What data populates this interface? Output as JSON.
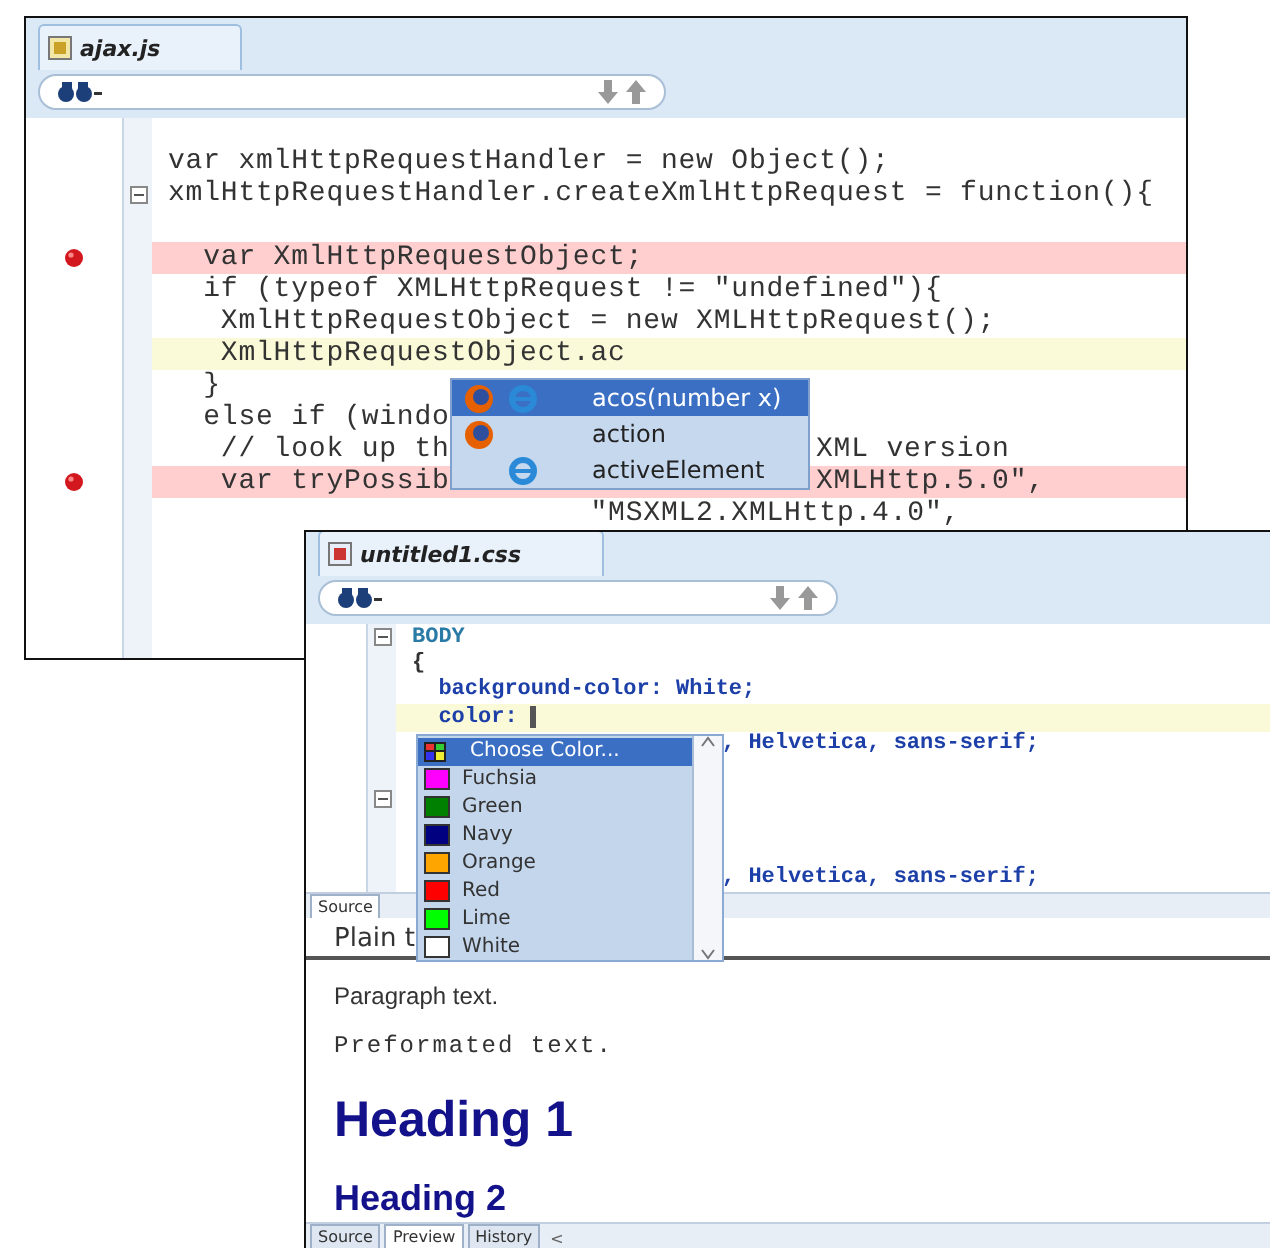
{
  "script_editor": {
    "tab": "ajax.js",
    "lines": [
      {
        "breakpoint": false,
        "current": false,
        "fold": false
      },
      {
        "text": "var xmlHttpRequestHandler = new Object();",
        "breakpoint": false,
        "current": false,
        "fold": false
      },
      {
        "text": "xmlHttpRequestHandler.createXmlHttpRequest = function(){",
        "breakpoint": false,
        "current": false,
        "fold": true
      },
      {
        "breakpoint": false,
        "current": false,
        "fold": false
      },
      {
        "text": "  var XmlHttpRequestObject;",
        "breakpoint": true,
        "current": false,
        "fold": false
      },
      {
        "text": "  if (typeof XMLHttpRequest != \"undefined\"){",
        "breakpoint": false,
        "current": false,
        "fold": false
      },
      {
        "text": "   XmlHttpRequestObject = new XMLHttpRequest();",
        "breakpoint": false,
        "current": false,
        "fold": false
      },
      {
        "text": "   XmlHttpRequestObject.ac",
        "breakpoint": false,
        "current": true,
        "fold": false
      },
      {
        "text": "  }",
        "breakpoint": false,
        "current": false,
        "fold": false
      },
      {
        "text": "  else if (windo",
        "breakpoint": false,
        "current": false,
        "fold": false
      },
      {
        "text": "   // look up th",
        "text_after": "XML version",
        "breakpoint": false,
        "current": false,
        "fold": false
      },
      {
        "text": "   var tryPossib",
        "text_after": "XMLHttp.5.0\",",
        "breakpoint": true,
        "current": false,
        "fold": false
      },
      {
        "text": "                        \"MSXML2.XMLHttp.4.0\",",
        "breakpoint": false,
        "current": false,
        "fold": false
      }
    ],
    "completion": [
      {
        "label": "acos(number x)",
        "selected": true,
        "firefox": true,
        "ie": true
      },
      {
        "label": "action",
        "selected": false,
        "firefox": true,
        "ie": false
      },
      {
        "label": "activeElement",
        "selected": false,
        "firefox": false,
        "ie": true
      }
    ]
  },
  "css_editor": {
    "tab": "untitled1.css",
    "lines": [
      {
        "text": "BODY",
        "kind": "selector",
        "current": false,
        "fold": true
      },
      {
        "text": "{",
        "kind": "plain",
        "current": false,
        "fold": false
      },
      {
        "text": "  background-color: White;",
        "kind": "rule",
        "current": false,
        "fold": false
      },
      {
        "text": "  color: ",
        "kind": "rule",
        "current": true,
        "fold": false
      },
      {
        "text_after": ", Helvetica, sans-serif;",
        "kind": "rule",
        "current": false,
        "fold": false
      },
      {
        "current": false,
        "fold": false
      },
      {
        "current": false,
        "fold": true
      },
      {
        "current": false,
        "fold": false
      },
      {
        "current": false,
        "fold": false
      },
      {
        "text_after": ", Helvetica, sans-serif;",
        "kind": "rule",
        "current": false,
        "fold": false
      }
    ],
    "source_tab": "Source",
    "color_menu": [
      {
        "label": "Choose Color...",
        "kind": "chooser",
        "selected": true
      },
      {
        "label": "Fuchsia",
        "kind": "swatch",
        "color": "#ff00ff",
        "selected": false
      },
      {
        "label": "Green",
        "kind": "swatch",
        "color": "#008000",
        "selected": false
      },
      {
        "label": "Navy",
        "kind": "swatch",
        "color": "#000080",
        "selected": false
      },
      {
        "label": "Orange",
        "kind": "swatch",
        "color": "#ffa500",
        "selected": false
      },
      {
        "label": "Red",
        "kind": "swatch",
        "color": "#ff0000",
        "selected": false
      },
      {
        "label": "Lime",
        "kind": "swatch",
        "color": "#00ff00",
        "selected": false
      },
      {
        "label": "White",
        "kind": "swatch",
        "color": "#ffffff",
        "selected": false
      }
    ],
    "preview": [
      {
        "kind": "plain",
        "text": "Plain t"
      },
      {
        "kind": "paragraph",
        "text": "Paragraph text."
      },
      {
        "kind": "pre",
        "text": "Preformated text."
      },
      {
        "kind": "h1",
        "text": "Heading 1"
      },
      {
        "kind": "h2",
        "text": "Heading 2"
      }
    ],
    "view_tabs": [
      {
        "label": "Source",
        "selected": false
      },
      {
        "label": "Preview",
        "selected": true
      },
      {
        "label": "History",
        "selected": false
      }
    ],
    "scroll_left": "<"
  }
}
